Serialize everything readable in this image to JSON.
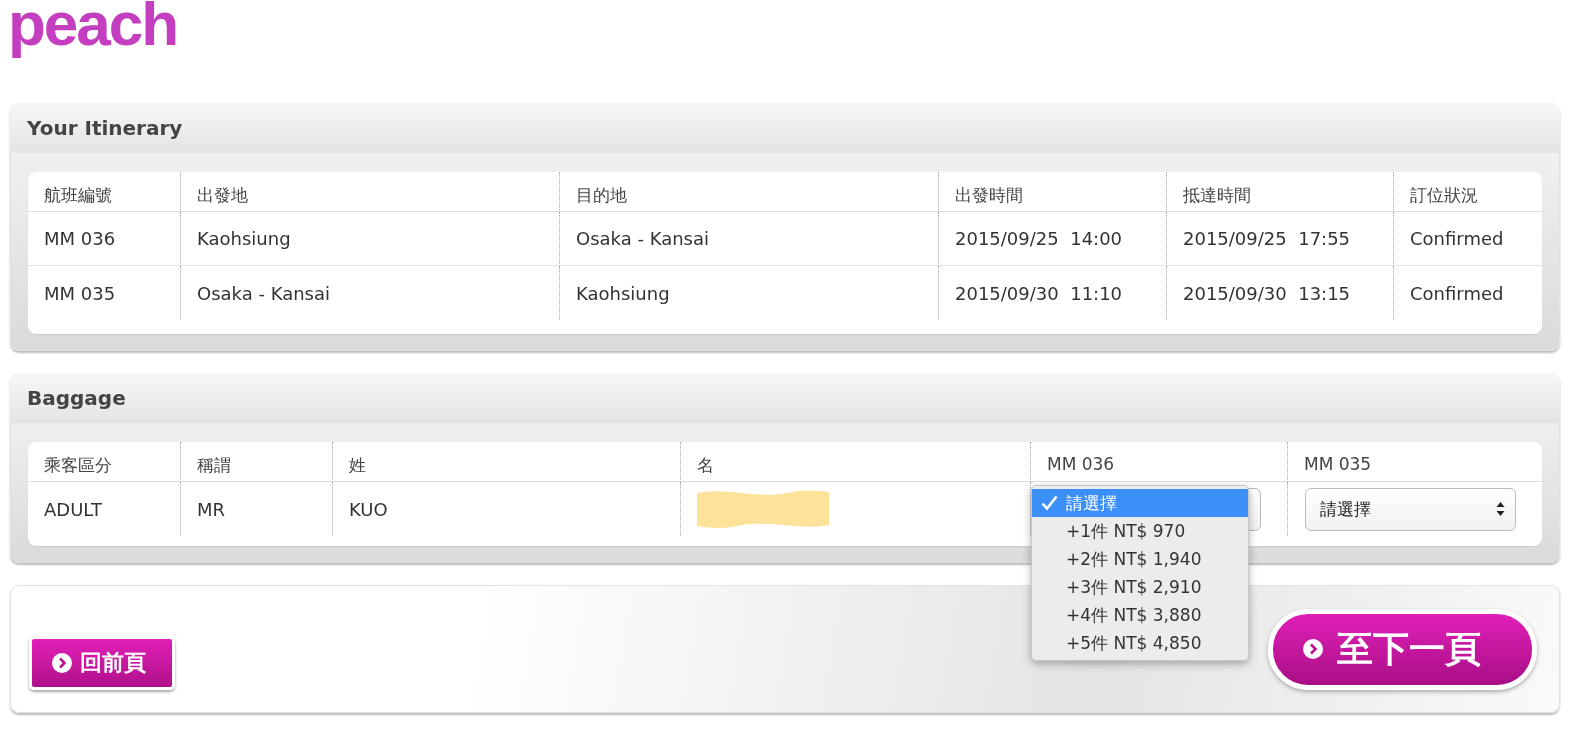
{
  "logo": "peach",
  "itinerary": {
    "title": "Your Itinerary",
    "columns": [
      "航班編號",
      "出發地",
      "目的地",
      "出發時間",
      "抵達時間",
      "訂位狀況"
    ],
    "rows": [
      [
        "MM 036",
        "Kaohsiung",
        "Osaka - Kansai",
        "2015/09/25  14:00",
        "2015/09/25  17:55",
        "Confirmed"
      ],
      [
        "MM 035",
        "Osaka - Kansai",
        "Kaohsiung",
        "2015/09/30  11:10",
        "2015/09/30  13:15",
        "Confirmed"
      ]
    ]
  },
  "baggage": {
    "title": "Baggage",
    "columns": [
      "乘客區分",
      "稱謂",
      "姓",
      "名",
      "MM 036",
      "MM 035"
    ],
    "rows": [
      {
        "cells": [
          "ADULT",
          "MR",
          "KUO"
        ],
        "first_name_redacted": true,
        "selects": [
          {
            "open": true,
            "options": [
              {
                "label": "請選擇",
                "selected": true
              },
              {
                "label": "+1件 NT$ 970",
                "selected": false
              },
              {
                "label": "+2件 NT$ 1,940",
                "selected": false
              },
              {
                "label": "+3件 NT$ 2,910",
                "selected": false
              },
              {
                "label": "+4件 NT$ 3,880",
                "selected": false
              },
              {
                "label": "+5件 NT$ 4,850",
                "selected": false
              }
            ]
          },
          {
            "open": false,
            "value": "請選擇"
          }
        ]
      }
    ]
  },
  "buttons": {
    "back": "回前頁",
    "next": "至下一頁"
  }
}
